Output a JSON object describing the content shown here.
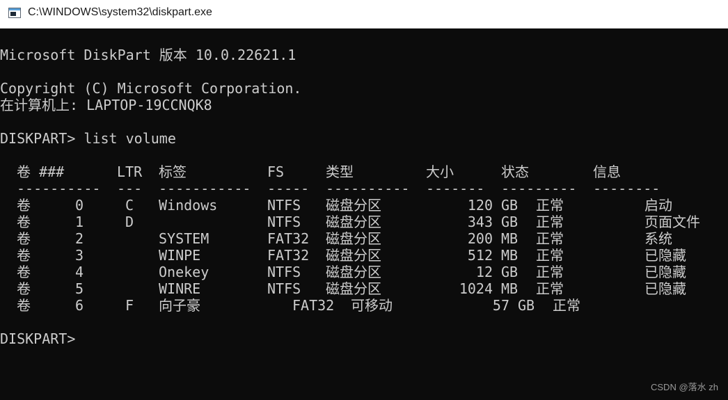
{
  "window": {
    "title": "C:\\WINDOWS\\system32\\diskpart.exe",
    "icon": "console-window-icon"
  },
  "console": {
    "banner": "Microsoft DiskPart 版本 10.0.22621.1",
    "copyright": "Copyright (C) Microsoft Corporation.",
    "computer": "在计算机上: LAPTOP-19CCNQK8",
    "command": "DISKPART> list volume",
    "prompt": "DISKPART>"
  },
  "table": {
    "headers": {
      "volume": "卷 ###",
      "ltr": "LTR",
      "label": "标签",
      "fs": "FS",
      "type": "类型",
      "size": "大小",
      "status": "状态",
      "info": "信息"
    },
    "separators": {
      "volume": "----------",
      "ltr": "---",
      "label": "-----------",
      "fs": "-----",
      "type": "----------",
      "size": "-------",
      "status": "---------",
      "info": "--------"
    },
    "rows": [
      {
        "vol": "卷",
        "num": "0",
        "ltr": "C",
        "label": "Windows",
        "fs": "NTFS",
        "type": "磁盘分区",
        "size": "120",
        "unit": "GB",
        "status": "正常",
        "info": "启动"
      },
      {
        "vol": "卷",
        "num": "1",
        "ltr": "D",
        "label": "",
        "fs": "NTFS",
        "type": "磁盘分区",
        "size": "343",
        "unit": "GB",
        "status": "正常",
        "info": "页面文件"
      },
      {
        "vol": "卷",
        "num": "2",
        "ltr": "",
        "label": "SYSTEM",
        "fs": "FAT32",
        "type": "磁盘分区",
        "size": "200",
        "unit": "MB",
        "status": "正常",
        "info": "系统"
      },
      {
        "vol": "卷",
        "num": "3",
        "ltr": "",
        "label": "WINPE",
        "fs": "FAT32",
        "type": "磁盘分区",
        "size": "512",
        "unit": "MB",
        "status": "正常",
        "info": "已隐藏"
      },
      {
        "vol": "卷",
        "num": "4",
        "ltr": "",
        "label": "Onekey",
        "fs": "NTFS",
        "type": "磁盘分区",
        "size": "12",
        "unit": "GB",
        "status": "正常",
        "info": "已隐藏"
      },
      {
        "vol": "卷",
        "num": "5",
        "ltr": "",
        "label": "WINRE",
        "fs": "NTFS",
        "type": "磁盘分区",
        "size": "1024",
        "unit": "MB",
        "status": "正常",
        "info": "已隐藏"
      },
      {
        "vol": "卷",
        "num": "6",
        "ltr": "F",
        "label": "向子豪",
        "fs": "FAT32",
        "type": "可移动",
        "size": "57",
        "unit": "GB",
        "status": "正常",
        "info": ""
      }
    ]
  },
  "watermark": "CSDN @落水 zh"
}
